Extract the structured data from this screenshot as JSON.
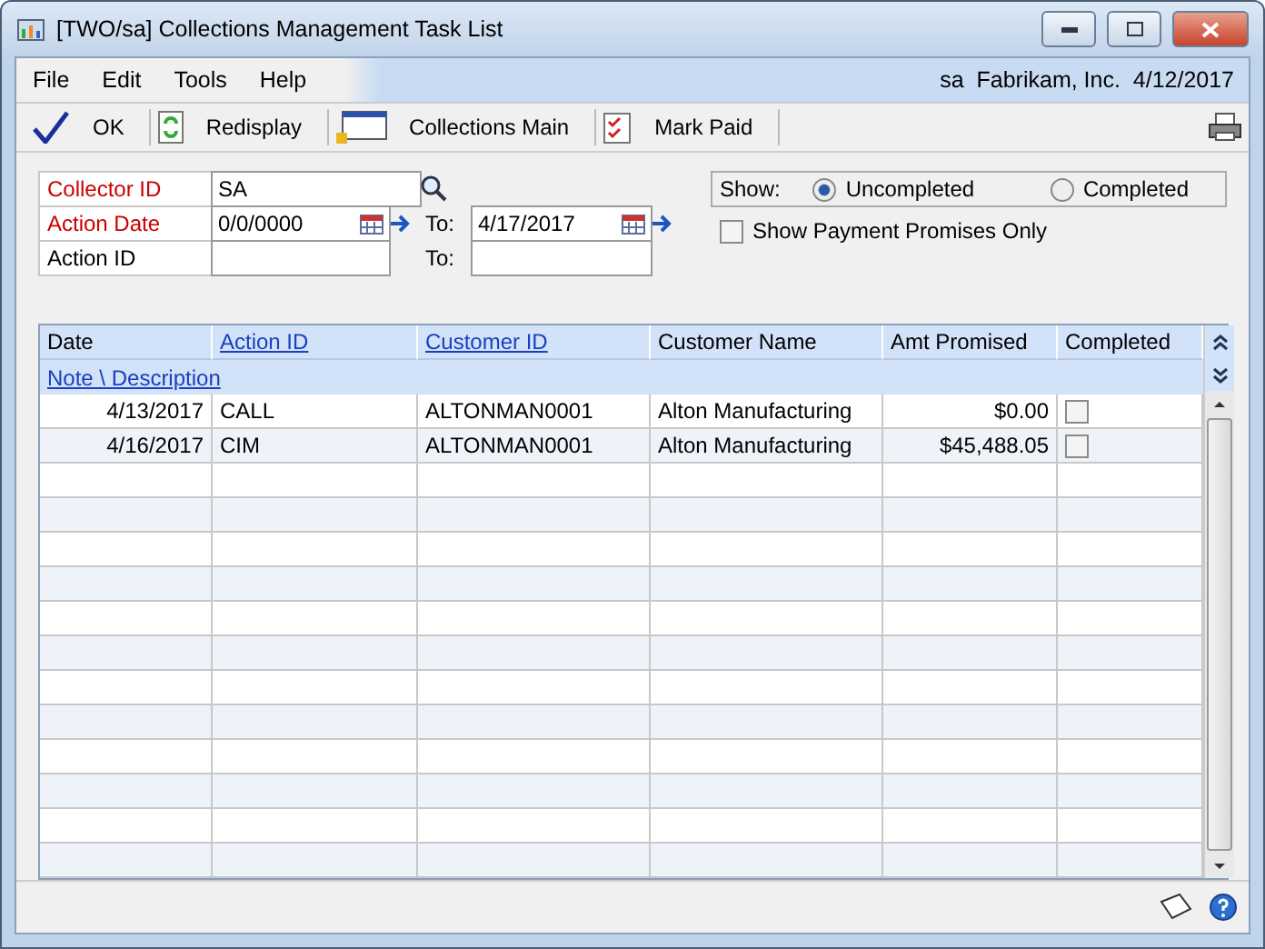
{
  "window": {
    "title": "[TWO/sa] Collections Management Task List"
  },
  "menu": [
    "File",
    "Edit",
    "Tools",
    "Help"
  ],
  "status": {
    "user": "sa",
    "company": "Fabrikam, Inc.",
    "date": "4/12/2017"
  },
  "toolbar": [
    {
      "kind": "check",
      "label": "OK"
    },
    {
      "kind": "refresh",
      "label": "Redisplay"
    },
    {
      "kind": "window",
      "label": "Collections Main"
    },
    {
      "kind": "clipboard",
      "label": "Mark Paid"
    }
  ],
  "filters": [
    {
      "label": "Collector ID",
      "required": true,
      "value": "SA",
      "kind": "lookup"
    },
    {
      "label": "Action Date",
      "required": true,
      "value": "0/0/0000",
      "kind": "date",
      "to_label": "To:",
      "to_value": "4/17/2017"
    },
    {
      "label": "Action ID",
      "required": false,
      "kind": "range",
      "to_label": "To:"
    }
  ],
  "show": {
    "label": "Show:",
    "options": [
      {
        "label": "Uncompleted",
        "selected": true
      },
      {
        "label": "Completed",
        "selected": false
      }
    ]
  },
  "promises_only": {
    "label": "Show Payment Promises Only",
    "checked": false
  },
  "table": {
    "columns": [
      {
        "label": "Date",
        "link": false
      },
      {
        "label": "Action ID",
        "link": true
      },
      {
        "label": "Customer ID",
        "link": true
      },
      {
        "label": "Customer Name",
        "link": false
      },
      {
        "label": "Amt Promised",
        "link": false
      },
      {
        "label": "Completed",
        "link": false
      }
    ],
    "subheader": "Note \\ Description",
    "rows": [
      {
        "date": "4/13/2017",
        "action_id": "CALL",
        "customer_id": "ALTONMAN0001",
        "customer_name": "Alton Manufacturing",
        "amount": "$0.00",
        "completed": false
      },
      {
        "date": "4/16/2017",
        "action_id": "CIM",
        "customer_id": "ALTONMAN0001",
        "customer_name": "Alton Manufacturing",
        "amount": "$45,488.05",
        "completed": false
      }
    ]
  }
}
